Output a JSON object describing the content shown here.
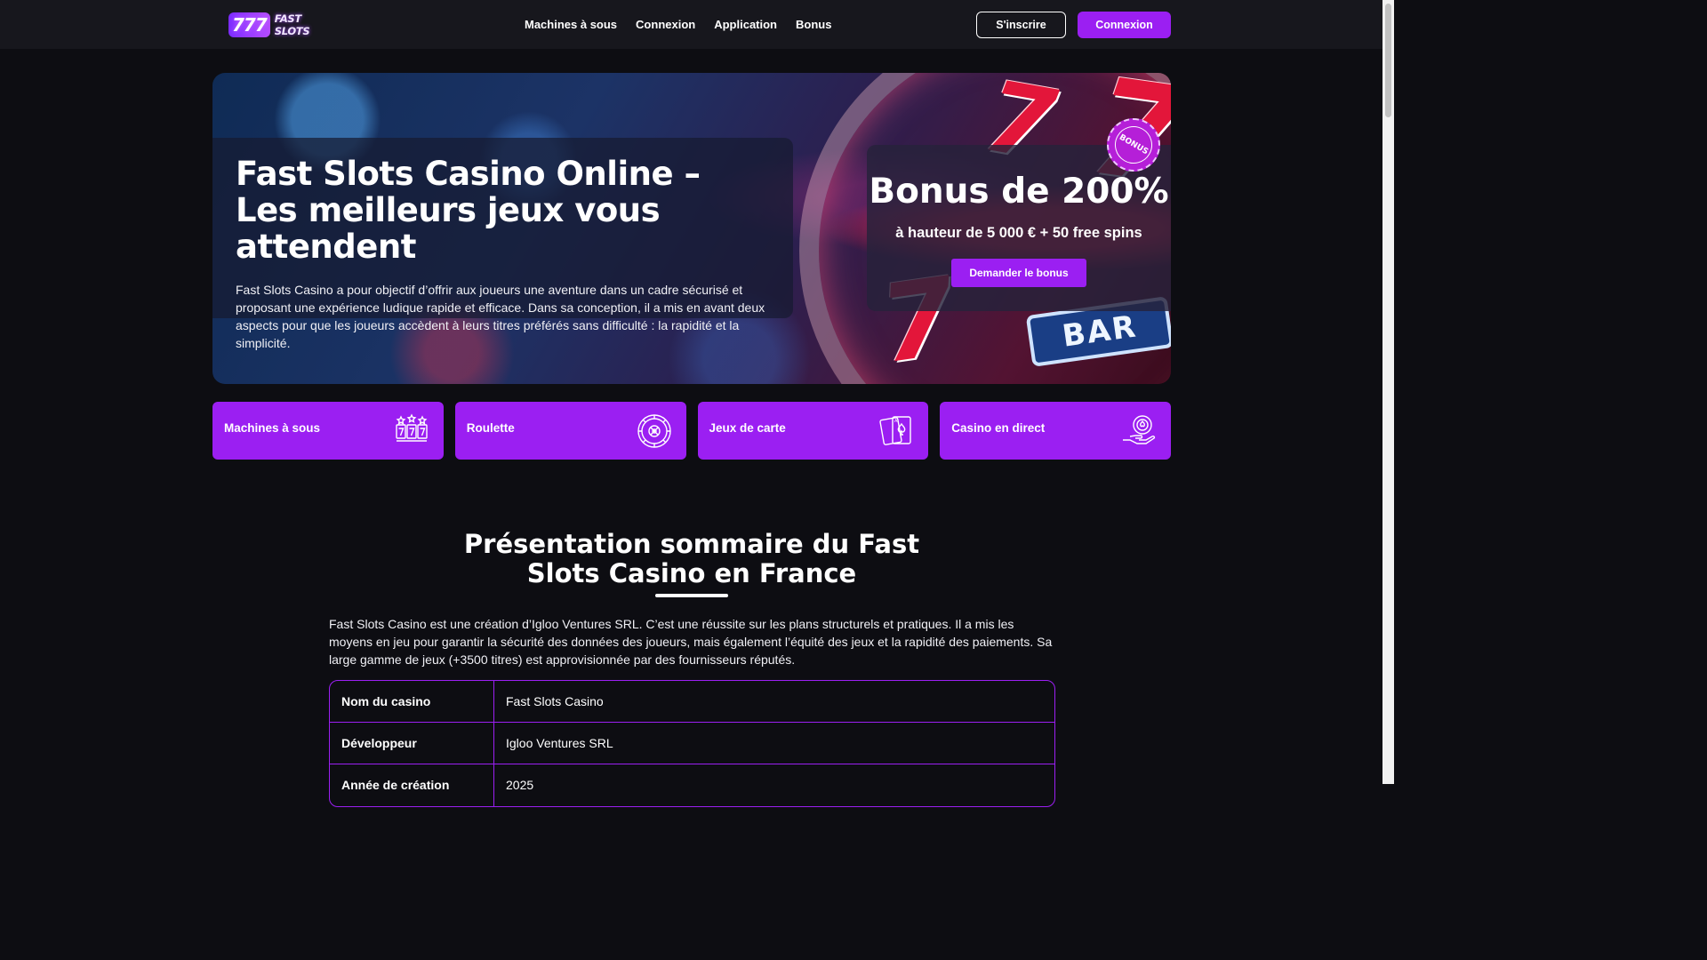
{
  "header": {
    "logo_digits": "777",
    "logo_text": "FAST SLOTS",
    "nav": [
      "Machines à sous",
      "Connexion",
      "Application",
      "Bonus"
    ],
    "signup_label": "S'inscrire",
    "login_label": "Connexion"
  },
  "hero": {
    "title": "Fast Slots Casino Online – Les meilleurs jeux vous attendent",
    "description": "Fast Slots Casino a pour objectif d’offrir aux joueurs une aventure dans un cadre sécurisé et proposant une expérience ludique rapide et efficace. Dans sa conception, il a mis en avant deux aspects pour que les joueurs accèdent à leurs titres préférés sans difficulté : la rapidité et la simplicité.",
    "bonus": {
      "badge": "BONUS",
      "title": "Bonus de 200%",
      "subtitle": "à hauteur de 5 000 € + 50 free spins",
      "button": "Demander le bonus"
    }
  },
  "categories": [
    {
      "label": "Machines à sous",
      "icon": "slot-machine-icon"
    },
    {
      "label": "Roulette",
      "icon": "roulette-icon"
    },
    {
      "label": "Jeux de carte",
      "icon": "cards-icon"
    },
    {
      "label": "Casino en direct",
      "icon": "live-casino-icon"
    }
  ],
  "section": {
    "title": "Présentation sommaire du Fast Slots Casino en France",
    "body": "Fast Slots Casino est une création d’Igloo Ventures SRL. C’est une réussite sur les plans structurels et pratiques. Il a mis les moyens en jeu pour garantir la sécurité des données des joueurs, mais également l’équité des jeux et la rapidité des paiements. Sa large gamme de jeux (+3500 titres) est approvisionnée par des fournisseurs réputés.",
    "table": [
      {
        "key": "Nom du casino",
        "value": "Fast Slots Casino"
      },
      {
        "key": "Développeur",
        "value": "Igloo Ventures SRL"
      },
      {
        "key": "Année de création",
        "value": "2025"
      }
    ]
  },
  "colors": {
    "accent": "#9b1ff2",
    "background": "#0d0d12",
    "header": "#17171d"
  }
}
